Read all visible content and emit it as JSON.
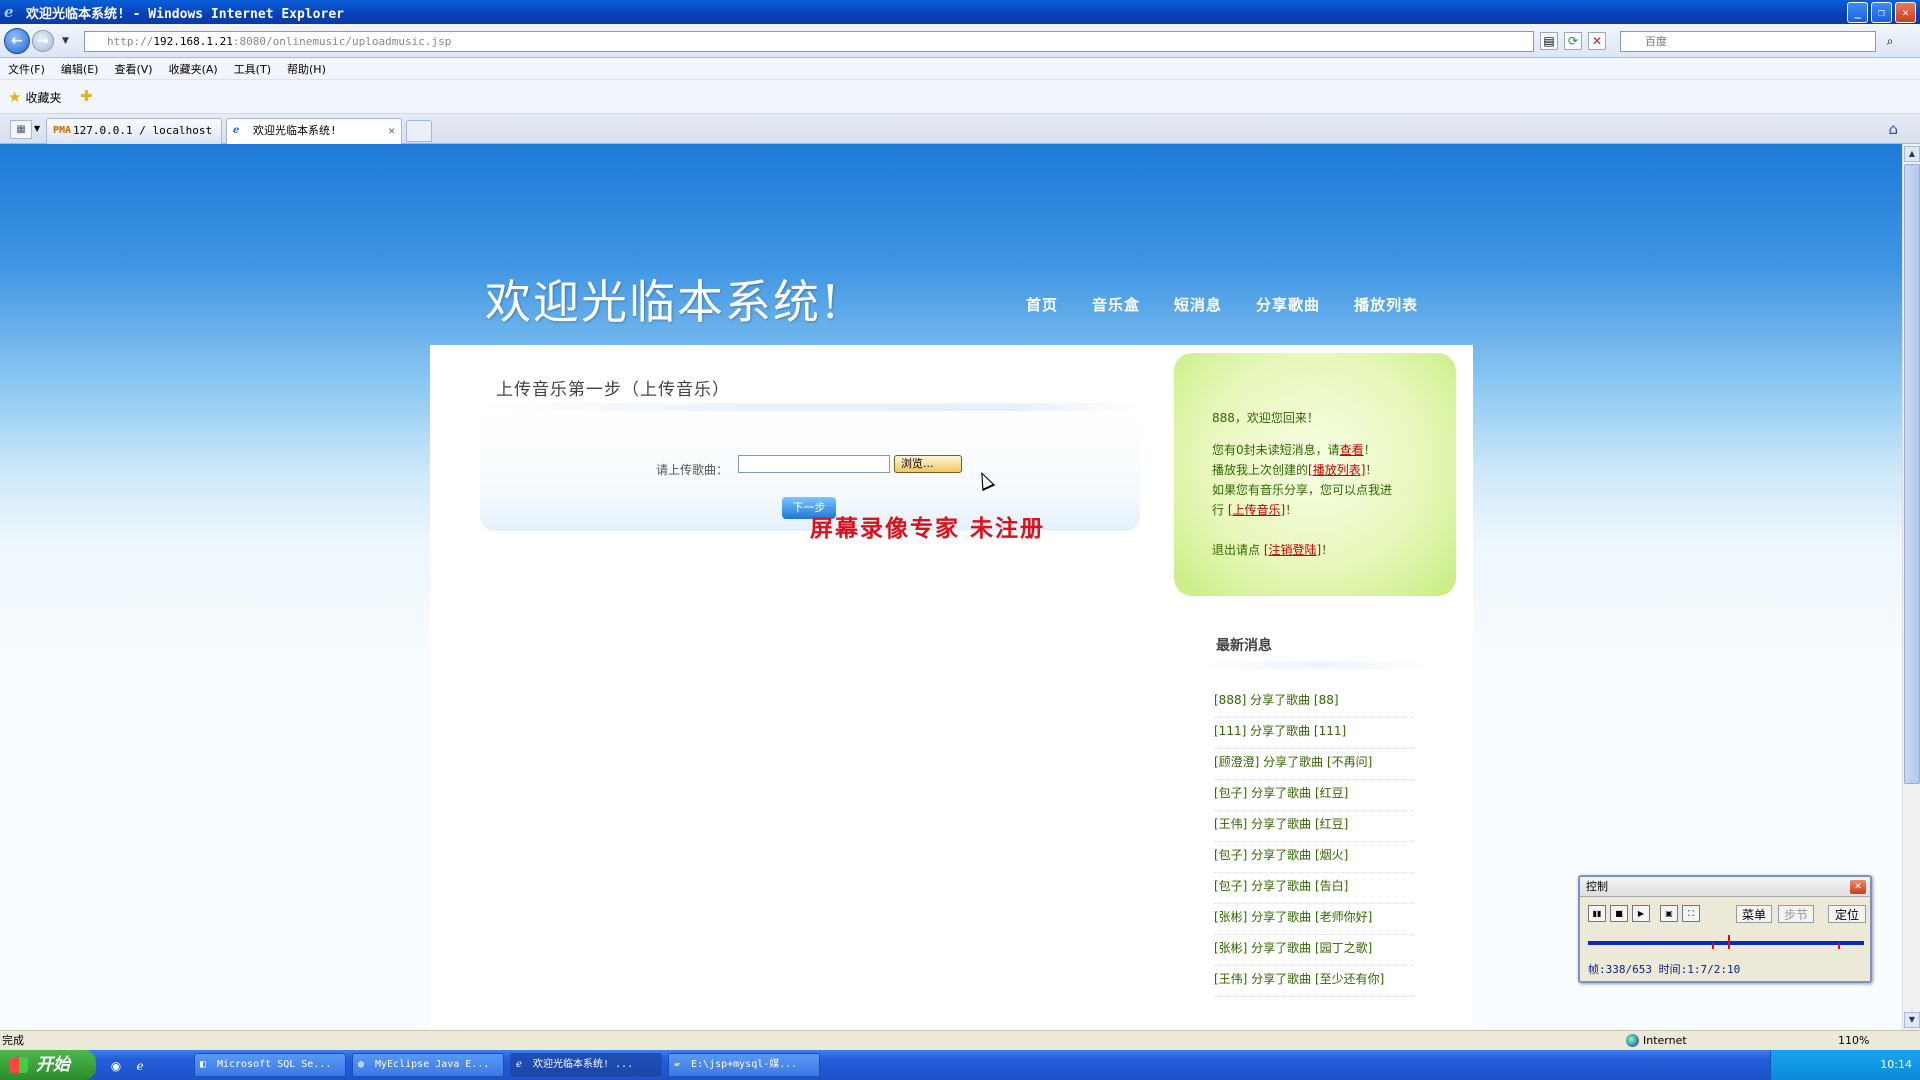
{
  "window": {
    "title": "欢迎光临本系统! - Windows Internet Explorer"
  },
  "addressbar": {
    "url_prefix": "http://",
    "url_host": "192.168.1.21",
    "url_rest": ":8080/onlinemusic/uploadmusic.jsp",
    "search_placeholder": "百度"
  },
  "menu": [
    "文件(F)",
    "编辑(E)",
    "查看(V)",
    "收藏夹(A)",
    "工具(T)",
    "帮助(H)"
  ],
  "favorites": {
    "label": "收藏夹"
  },
  "tabs": [
    {
      "label": "127.0.0.1 / localhost ..."
    },
    {
      "label": "欢迎光临本系统!"
    }
  ],
  "site": {
    "title": "欢迎光临本系统!",
    "nav": [
      "首页",
      "音乐盒",
      "短消息",
      "分享歌曲",
      "播放列表"
    ]
  },
  "upload": {
    "title": "上传音乐第一步（上传音乐）",
    "label": "请上传歌曲：",
    "browse": "浏览...",
    "next": "下一步"
  },
  "watermark": "屏幕录像专家  未注册",
  "sidebar": {
    "greeting": "888，欢迎您回来！",
    "msg_pre": "您有0封未读短消息，请",
    "msg_link": "查看",
    "msg_post": "！",
    "playlist_pre": "播放我上次创建的",
    "playlist_link": "[播放列表]",
    "playlist_post": "！",
    "share_pre1": "如果您有音乐分享，您可以点我进",
    "share_pre2": "行",
    "share_link": "[上传音乐]",
    "share_post": "！",
    "logout_pre": "退出请点",
    "logout_link": "[注销登陆]",
    "logout_post": "！",
    "news_title": "最新消息",
    "news": [
      "[888] 分享了歌曲 [88]",
      "[111] 分享了歌曲 [111]",
      "[顾澄澄] 分享了歌曲 [不再问]",
      "[包子] 分享了歌曲 [红豆]",
      "[王伟] 分享了歌曲 [红豆]",
      "[包子] 分享了歌曲 [烟火]",
      "[包子] 分享了歌曲 [告白]",
      "[张彬] 分享了歌曲 [老师你好]",
      "[张彬] 分享了歌曲 [园丁之歌]",
      "[王伟] 分享了歌曲 [至少还有你]"
    ]
  },
  "recorder": {
    "title": "控制",
    "menu": "菜单",
    "step": "步节",
    "locate": "定位",
    "status": "帧:338/653 时间:1:7/2:10"
  },
  "statusbar": {
    "left": "完成",
    "zone": "Internet",
    "zoom": "110%"
  },
  "taskbar": {
    "start": "开始",
    "tasks": [
      "Microsoft SQL Se...",
      "MyEclipse Java E...",
      "欢迎光临本系统! ...",
      "E:\\jsp+mysql-媒..."
    ],
    "clock": "10:14"
  }
}
